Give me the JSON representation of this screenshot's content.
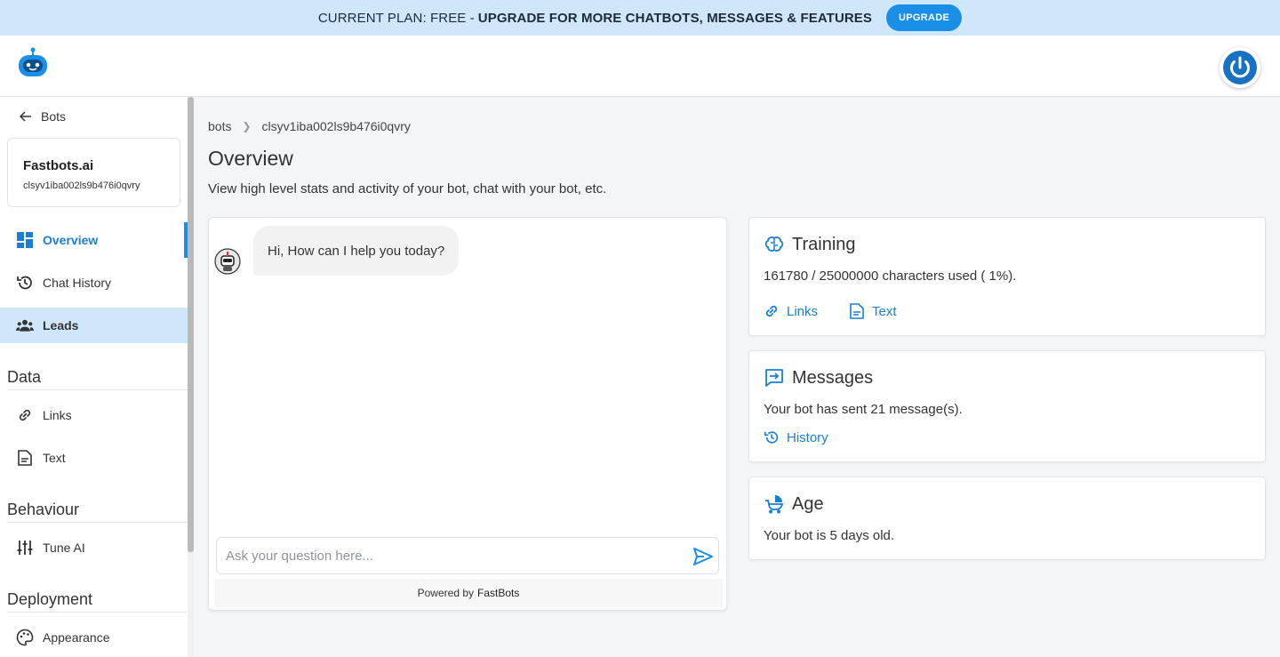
{
  "banner": {
    "plan_text": "CURRENT PLAN: FREE -",
    "upgrade_text": "UPGRADE FOR MORE CHATBOTS, MESSAGES & FEATURES",
    "upgrade_button": "UPGRADE"
  },
  "header": {
    "logo_icon": "robot-logo-icon",
    "power_icon": "power-icon"
  },
  "sidebar": {
    "back_label": "Bots",
    "bot_name": "Fastbots.ai",
    "bot_id": "clsyv1iba002ls9b476i0qvry",
    "nav": [
      {
        "label": "Overview",
        "icon": "dashboard-icon",
        "active": true
      },
      {
        "label": "Chat History",
        "icon": "history-icon"
      },
      {
        "label": "Leads",
        "icon": "users-icon",
        "highlighted": true
      }
    ],
    "sections": {
      "data": {
        "title": "Data",
        "items": [
          {
            "label": "Links",
            "icon": "link-icon"
          },
          {
            "label": "Text",
            "icon": "document-icon"
          }
        ]
      },
      "behaviour": {
        "title": "Behaviour",
        "items": [
          {
            "label": "Tune AI",
            "icon": "sliders-icon"
          }
        ]
      },
      "deployment": {
        "title": "Deployment",
        "items": [
          {
            "label": "Appearance",
            "icon": "palette-icon"
          }
        ]
      }
    }
  },
  "breadcrumb": {
    "root": "bots",
    "current": "clsyv1iba002ls9b476i0qvry"
  },
  "page": {
    "title": "Overview",
    "subtitle": "View high level stats and activity of your bot, chat with your bot, etc."
  },
  "chat": {
    "greeting": "Hi, How can I help you today?",
    "input_placeholder": "Ask your question here...",
    "powered_by": "Powered by",
    "brand": "FastBots"
  },
  "cards": {
    "training": {
      "title": "Training",
      "text": "161780 / 25000000 characters used ( 1%).",
      "links_label": "Links",
      "text_label": "Text"
    },
    "messages": {
      "title": "Messages",
      "text": "Your bot has sent 21 message(s).",
      "history_label": "History"
    },
    "age": {
      "title": "Age",
      "text": "Your bot is 5 days old."
    }
  },
  "colors": {
    "accent": "#1a8fe8",
    "banner_bg": "#cfe7fb",
    "link": "#1a7fd4"
  }
}
